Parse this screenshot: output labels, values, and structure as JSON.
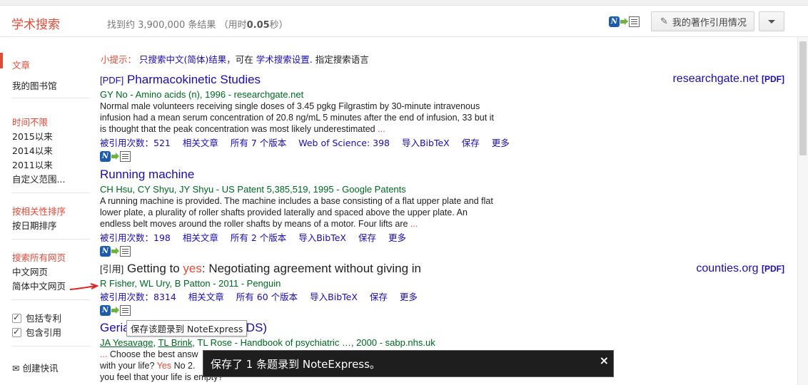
{
  "header": {
    "brand": "学术搜索",
    "result_count": "找到约 3,900,000 条结果",
    "time_open": "（用时",
    "time_value": "0.05",
    "time_close": "秒）",
    "cite_button": "我的著作引用情况"
  },
  "sidebar": {
    "articles": "文章",
    "my_library": "我的图书馆",
    "time_any": "时间不限",
    "since_2015": "2015以来",
    "since_2014": "2014以来",
    "since_2011": "2011以来",
    "custom_range": "自定义范围...",
    "sort_relevance": "按相关性排序",
    "sort_date": "按日期排序",
    "lang_all": "搜索所有网页",
    "lang_chinese": "中文网页",
    "lang_simplified": "简体中文网页",
    "include_patents": "包括专利",
    "include_citations": "包含引用",
    "create_alert": "创建快讯"
  },
  "tip": {
    "prefix": "小提示：",
    "link1": "只搜索中文(简体)结果",
    "mid": "，可在",
    "link2": "学术搜索设置",
    "suffix": "指定搜索语言"
  },
  "results": [
    {
      "tag": "[PDF]",
      "title": "Pharmacokinetic Studies",
      "meta": "GY No - Amino acids (n), 1996 - researchgate.net",
      "snippet": "Normal male volunteers receiving single doses of 3.45 pgkg Filgrastim by 30-minute intravenous infusion had a mean serum concentration of 20.8 ng/mL 5 minutes after the end of infusion, 33 but it is thought that the peak concentration was most likely underestimated",
      "ellipsis": "...",
      "links": [
        "被引用次数：521",
        "相关文章",
        "所有 7 个版本",
        "Web of Science: 398",
        "导入BibTeX",
        "保存",
        "更多"
      ],
      "side_source": "researchgate.net",
      "side_type": "[PDF]"
    },
    {
      "tag": "",
      "title": "Running machine",
      "meta": "CH Hsu, CY Shyu, JY Shyu - US Patent 5,385,519, 1995 - Google Patents",
      "snippet": "A running machine is provided. The machine includes a base consisting of a flat upper plate and flat lower plate, a plurality of roller shafts provided laterally and spaced above the upper plate. An endless belt moves around the roller shafts by means of a motor. Four lifts are",
      "ellipsis": "...",
      "links": [
        "被引用次数：198",
        "相关文章",
        "所有 2 个版本",
        "导入BibTeX",
        "保存",
        "更多"
      ]
    },
    {
      "tag": "[引用]",
      "title_pre": "Getting to ",
      "title_hl": "yes",
      "title_post": ": Negotiating agreement without giving in",
      "meta": "R Fisher, WL Ury, B Patton - 2011 - Penguin",
      "links": [
        "被引用次数：8314",
        "相关文章",
        "所有 60 个版本",
        "导入BibTeX",
        "保存",
        "更多"
      ],
      "side_source": "counties.org",
      "side_type": "[PDF]"
    },
    {
      "title_a": "Geria",
      "title_b": "GDS)",
      "meta_a1": "JA Yesavage",
      "meta_a2": "TL Brink",
      "meta_rest": ", TL Rose - Handbook of psychiatric …, 2000 - sabp.nhs.uk",
      "snip1_ell": "...",
      "snip1": " Choose the best answ",
      "snip2_a": "with your life?",
      "snip2_hl": "Yes",
      "snip2_b": "No 2.",
      "snip3": "you feel that your life is empty?"
    }
  ],
  "tooltip": "保存该题录到 NoteExpress",
  "toast": {
    "message": "保存了 1 条题录到 NoteExpress。",
    "close": "×"
  },
  "colors": {
    "brand_red": "#dd4b39",
    "link_blue": "#1a0dab",
    "meta_green": "#006621"
  }
}
